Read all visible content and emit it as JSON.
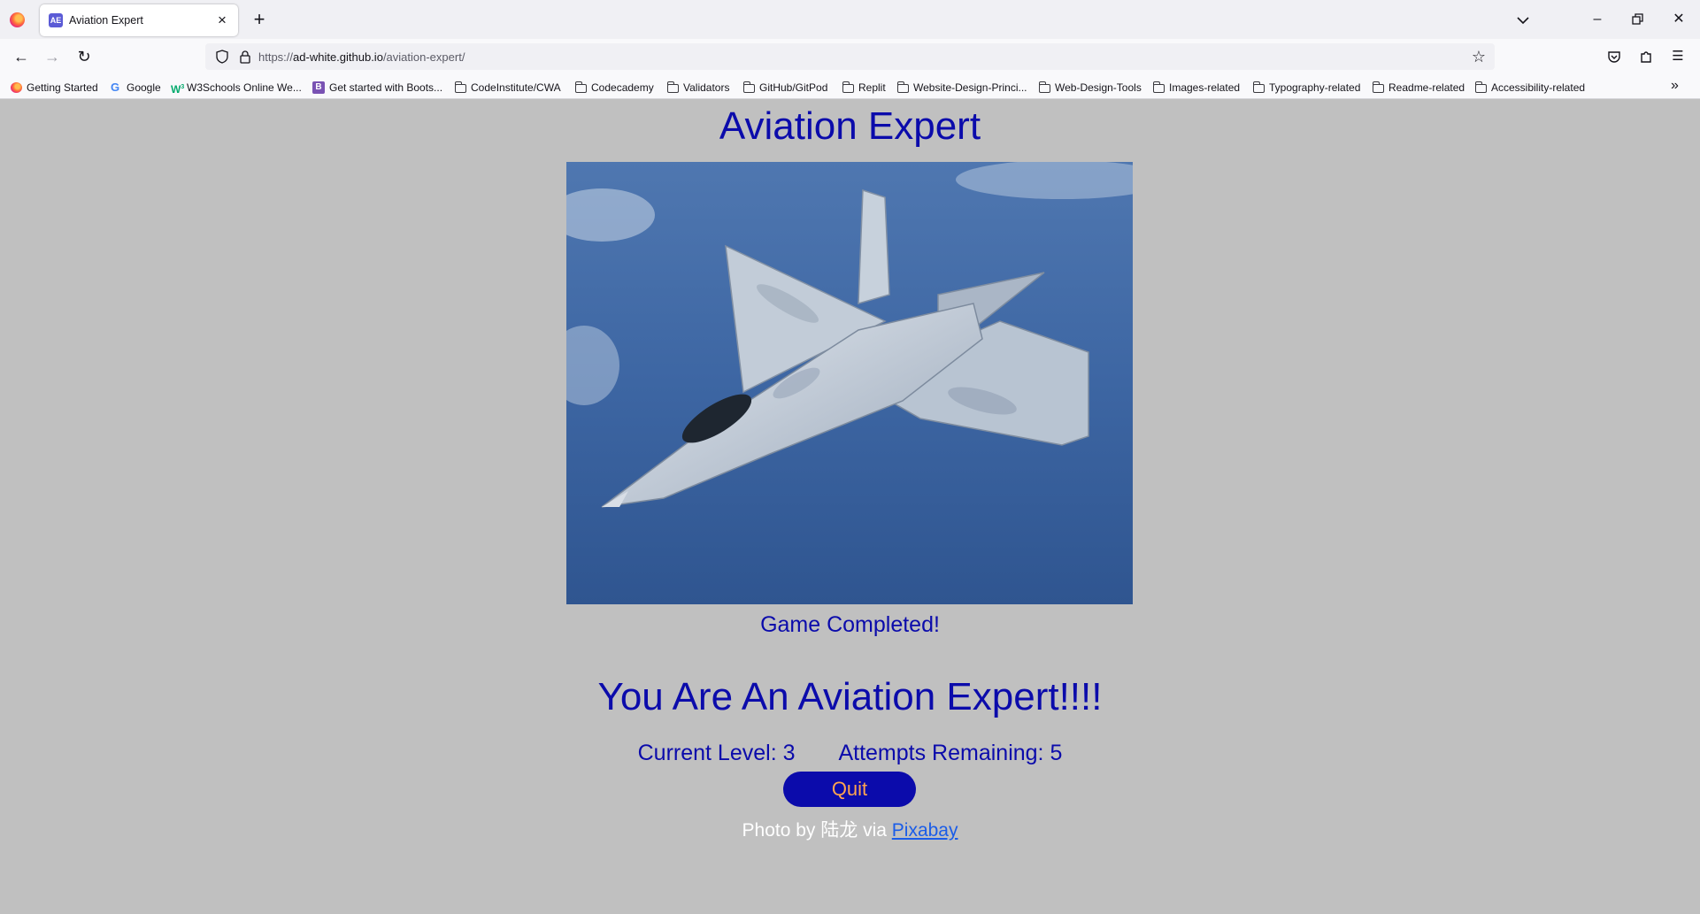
{
  "browser": {
    "tab": {
      "favicon": "AE",
      "title": "Aviation Expert"
    },
    "url": {
      "prefix": "https://",
      "host": "ad-white.github.io",
      "path": "/aviation-expert/"
    },
    "bookmarks": [
      {
        "label": "Getting Started",
        "icon": "firefox-icon"
      },
      {
        "label": "Google",
        "icon": "google-icon"
      },
      {
        "label": "W3Schools Online We...",
        "icon": "w3schools-icon"
      },
      {
        "label": "Get started with Boots...",
        "icon": "bootstrap-icon"
      },
      {
        "label": "CodeInstitute/CWA",
        "icon": "folder-icon"
      },
      {
        "label": "Codecademy",
        "icon": "folder-icon"
      },
      {
        "label": "Validators",
        "icon": "folder-icon"
      },
      {
        "label": "GitHub/GitPod",
        "icon": "folder-icon"
      },
      {
        "label": "Replit",
        "icon": "folder-icon"
      },
      {
        "label": "Website-Design-Princi...",
        "icon": "folder-icon"
      },
      {
        "label": "Web-Design-Tools",
        "icon": "folder-icon"
      },
      {
        "label": "Images-related",
        "icon": "folder-icon"
      },
      {
        "label": "Typography-related",
        "icon": "folder-icon"
      },
      {
        "label": "Readme-related",
        "icon": "folder-icon"
      },
      {
        "label": "Accessibility-related",
        "icon": "folder-icon"
      }
    ]
  },
  "page": {
    "title": "Aviation Expert",
    "status": "Game Completed!",
    "result": "You Are An Aviation Expert!!!!",
    "level": "Current Level: 3",
    "attempts": "Attempts Remaining: 5",
    "quit_label": "Quit",
    "credit_prefix": "Photo by 陆龙 via",
    "credit_link": "Pixabay"
  },
  "colors": {
    "page_bg": "#c0c0c0",
    "heading": "#0b0bab",
    "button_bg": "#0b0bab",
    "button_text": "#ffa54f",
    "link": "#1a5ce8"
  }
}
